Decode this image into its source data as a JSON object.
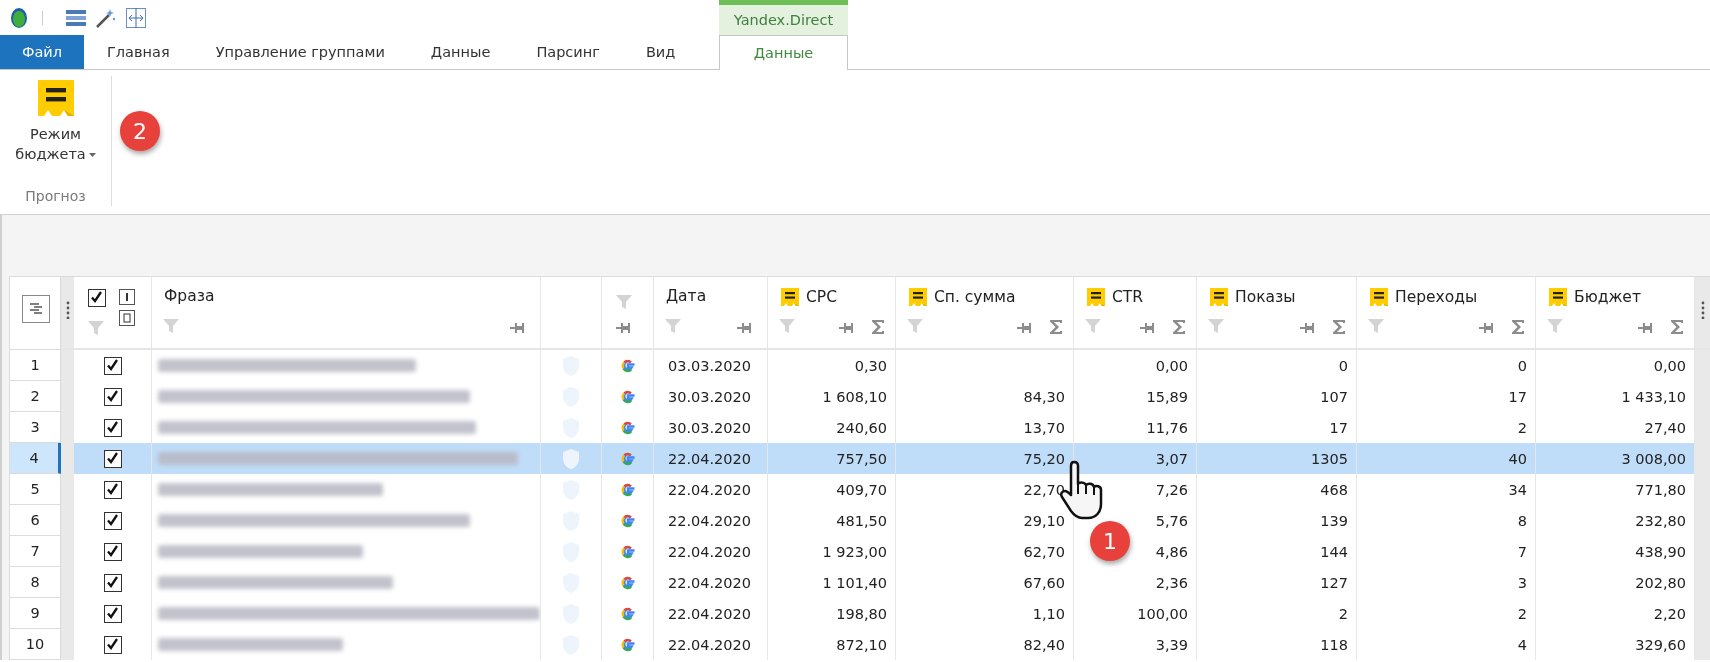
{
  "context_tab_group": {
    "title": "Yandex.Direct"
  },
  "tabs": [
    {
      "label": "Файл",
      "kind": "file",
      "selected": false
    },
    {
      "label": "Главная",
      "kind": "normal",
      "selected": false
    },
    {
      "label": "Управление группами",
      "kind": "normal",
      "selected": false
    },
    {
      "label": "Данные",
      "kind": "normal",
      "selected": false
    },
    {
      "label": "Парсинг",
      "kind": "normal",
      "selected": false
    },
    {
      "label": "Вид",
      "kind": "normal",
      "selected": false
    },
    {
      "label": "Данные",
      "kind": "context",
      "selected": true
    }
  ],
  "ribbon": {
    "groups": [
      {
        "label": "Прогноз",
        "buttons": [
          {
            "label": "Режим бюджета",
            "dropdown": true
          }
        ]
      }
    ]
  },
  "table": {
    "select_all": {
      "checked": true
    },
    "columns": [
      {
        "kind": "phrase",
        "label": "Фраза"
      },
      {
        "kind": "status"
      },
      {
        "kind": "source"
      },
      {
        "kind": "date",
        "label": "Дата"
      },
      {
        "kind": "metric",
        "label": "CPC"
      },
      {
        "kind": "metric",
        "label": "Сп. сумма"
      },
      {
        "kind": "metric",
        "label": "CTR"
      },
      {
        "kind": "metric",
        "label": "Показы"
      },
      {
        "kind": "metric",
        "label": "Переходы"
      },
      {
        "kind": "metric",
        "label": "Бюджет"
      }
    ],
    "rows": [
      {
        "number": "1",
        "checked": true,
        "selected": false,
        "date": "03.03.2020",
        "cpc": "0,30",
        "ctr": "0,00",
        "impressions": "0",
        "clicks": "0",
        "budget": "0,00"
      },
      {
        "number": "2",
        "checked": true,
        "selected": false,
        "date": "30.03.2020",
        "cpc": "1 608,10",
        "sum": "84,30",
        "ctr": "15,89",
        "impressions": "107",
        "clicks": "17",
        "budget": "1 433,10"
      },
      {
        "number": "3",
        "checked": true,
        "selected": false,
        "date": "30.03.2020",
        "cpc": "240,60",
        "sum": "13,70",
        "ctr": "11,76",
        "impressions": "17",
        "clicks": "2",
        "budget": "27,40"
      },
      {
        "number": "4",
        "checked": true,
        "selected": true,
        "date": "22.04.2020",
        "cpc": "757,50",
        "sum": "75,20",
        "ctr": "3,07",
        "impressions": "1305",
        "clicks": "40",
        "budget": "3 008,00"
      },
      {
        "number": "5",
        "checked": true,
        "selected": false,
        "date": "22.04.2020",
        "cpc": "409,70",
        "sum": "22,70",
        "ctr": "7,26",
        "impressions": "468",
        "clicks": "34",
        "budget": "771,80"
      },
      {
        "number": "6",
        "checked": true,
        "selected": false,
        "date": "22.04.2020",
        "cpc": "481,50",
        "sum": "29,10",
        "ctr": "5,76",
        "impressions": "139",
        "clicks": "8",
        "budget": "232,80"
      },
      {
        "number": "7",
        "checked": true,
        "selected": false,
        "date": "22.04.2020",
        "cpc": "1 923,00",
        "sum": "62,70",
        "ctr": "4,86",
        "impressions": "144",
        "clicks": "7",
        "budget": "438,90"
      },
      {
        "number": "8",
        "checked": true,
        "selected": false,
        "date": "22.04.2020",
        "cpc": "1 101,40",
        "sum": "67,60",
        "ctr": "2,36",
        "impressions": "127",
        "clicks": "3",
        "budget": "202,80"
      },
      {
        "number": "9",
        "checked": true,
        "selected": false,
        "date": "22.04.2020",
        "cpc": "198,80",
        "sum": "1,10",
        "ctr": "100,00",
        "impressions": "2",
        "clicks": "2",
        "budget": "2,20"
      },
      {
        "number": "10",
        "checked": true,
        "selected": false,
        "date": "22.04.2020",
        "cpc": "872,10",
        "sum": "82,40",
        "ctr": "3,39",
        "impressions": "118",
        "clicks": "4",
        "budget": "329,60"
      }
    ]
  },
  "annotations": [
    {
      "label": "2"
    },
    {
      "label": "1"
    }
  ]
}
